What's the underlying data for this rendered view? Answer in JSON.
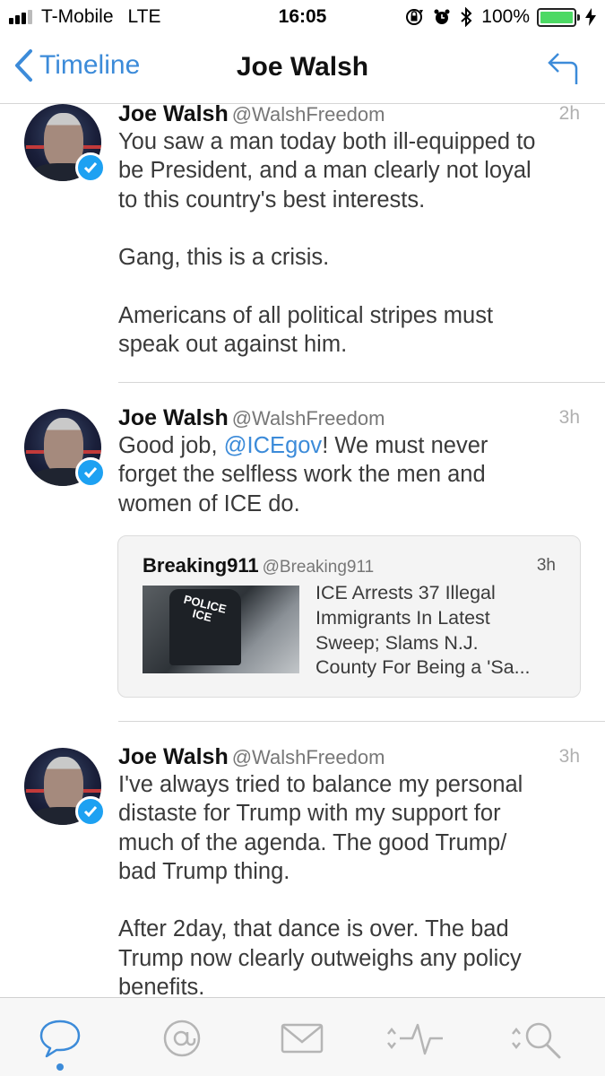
{
  "status_bar": {
    "carrier": "T-Mobile",
    "network": "LTE",
    "time": "16:05",
    "battery": "100%",
    "battery_level": 1.0,
    "signal_bars_filled": 3,
    "signal_bars_total": 4,
    "icons": [
      "rotation-lock-icon",
      "alarm-icon",
      "bluetooth-icon",
      "charging-bolt-icon"
    ]
  },
  "nav": {
    "back_label": "Timeline",
    "title": "Joe Walsh",
    "reply_icon": "reply-arrow-icon"
  },
  "tweets": [
    {
      "name": "Joe Walsh",
      "handle": "@WalshFreedom",
      "time": "2h",
      "verified": true,
      "lines": [
        "You saw a man today both ill-equipped to",
        "be President, and a man clearly not loyal",
        "to this country's best interests.",
        "",
        "Gang, this is a crisis.",
        "",
        "Americans of all political stripes must",
        "speak out against him."
      ]
    },
    {
      "name": "Joe Walsh",
      "handle": "@WalshFreedom",
      "time": "3h",
      "verified": true,
      "line1_before": "Good job, ",
      "line1_mention": "@ICEgov",
      "line1_after": "! We must never",
      "lines": [
        "forget the selfless work the men and",
        "women of ICE do."
      ],
      "quote": {
        "name": "Breaking911",
        "handle": "@Breaking911",
        "time": "3h",
        "image_text": [
          "POLICE",
          "ICE"
        ],
        "lines": [
          "ICE Arrests 37 Illegal",
          "Immigrants In Latest",
          "Sweep; Slams N.J.",
          "County For Being a 'Sa..."
        ]
      }
    },
    {
      "name": "Joe Walsh",
      "handle": "@WalshFreedom",
      "time": "3h",
      "verified": true,
      "lines": [
        "I've always tried to balance my personal",
        "distaste for Trump with my support for",
        "much of the agenda. The good Trump/",
        "bad Trump thing.",
        "",
        "After 2day, that dance is over. The bad",
        "Trump now clearly outweighs any policy",
        "benefits."
      ]
    }
  ],
  "tab_bar": {
    "tabs": [
      {
        "icon": "speech-bubble-icon",
        "active": true
      },
      {
        "icon": "at-sign-icon",
        "active": false
      },
      {
        "icon": "envelope-icon",
        "active": false
      },
      {
        "icon": "activity-icon",
        "active": false
      },
      {
        "icon": "search-icon",
        "active": false
      }
    ],
    "active_color": "#3c8bd9",
    "inactive_color": "#b5b5b5"
  },
  "colors": {
    "accent": "#3c8bd9",
    "verified": "#1da1f2",
    "battery": "#4cd964"
  }
}
